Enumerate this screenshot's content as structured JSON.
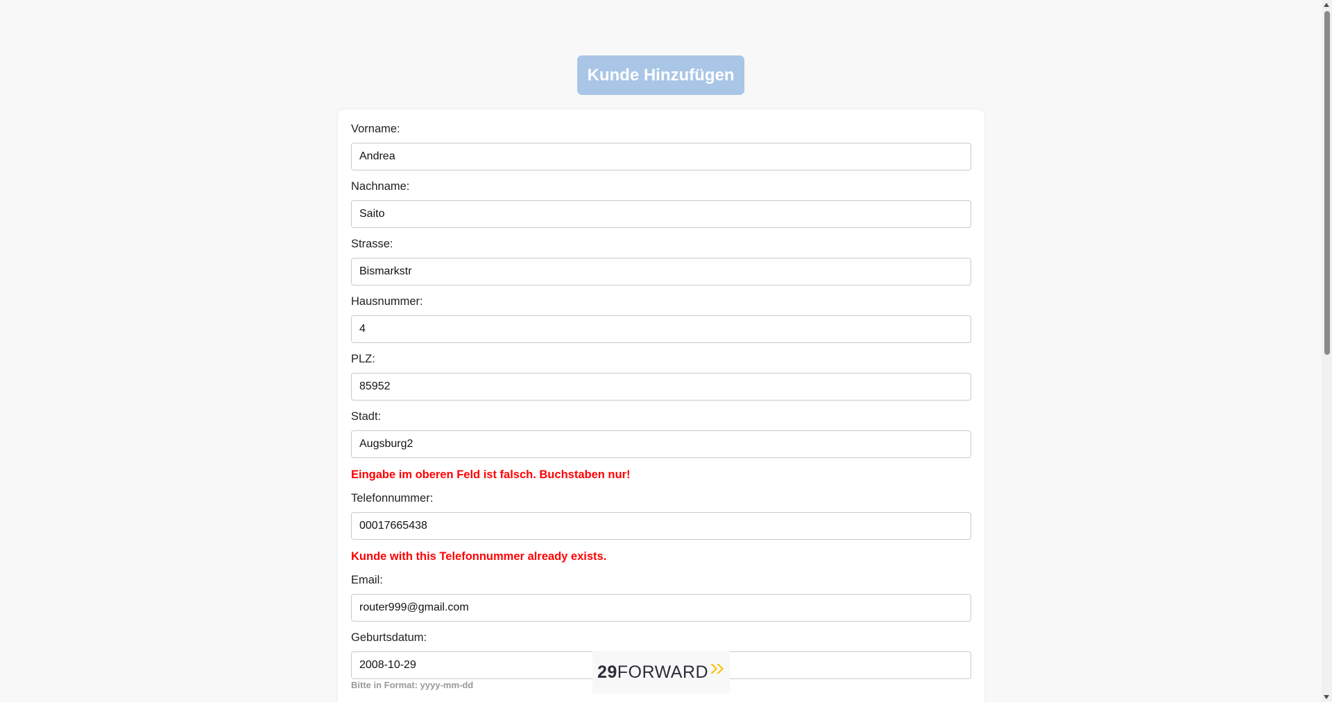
{
  "header": {
    "title": "Kunde Hinzufügen"
  },
  "form": {
    "vorname": {
      "label": "Vorname:",
      "value": "Andrea"
    },
    "nachname": {
      "label": "Nachname:",
      "value": "Saito"
    },
    "strasse": {
      "label": "Strasse:",
      "value": "Bismarkstr"
    },
    "hausnummer": {
      "label": "Hausnummer:",
      "value": "4"
    },
    "plz": {
      "label": "PLZ:",
      "value": "85952"
    },
    "stadt": {
      "label": "Stadt:",
      "value": "Augsburg2",
      "error": "Eingabe im oberen Feld ist falsch. Buchstaben nur!"
    },
    "telefon": {
      "label": "Telefonnummer:",
      "value": "00017665438",
      "error": "Kunde with this Telefonnummer already exists."
    },
    "email": {
      "label": "Email:",
      "value": "router999@gmail.com"
    },
    "geburtsdatum": {
      "label": "Geburtsdatum:",
      "value": "2008-10-29",
      "hint": "Bitte in Format: yyyy-mm-dd"
    }
  },
  "logo": {
    "number": "29",
    "word": "FORWARD",
    "icon": "double-chevron-right-icon",
    "accent_color": "#f5c400"
  },
  "colors": {
    "title_button": "#a9c6e6",
    "error": "#ff0000",
    "background": "#f8f8f8"
  }
}
